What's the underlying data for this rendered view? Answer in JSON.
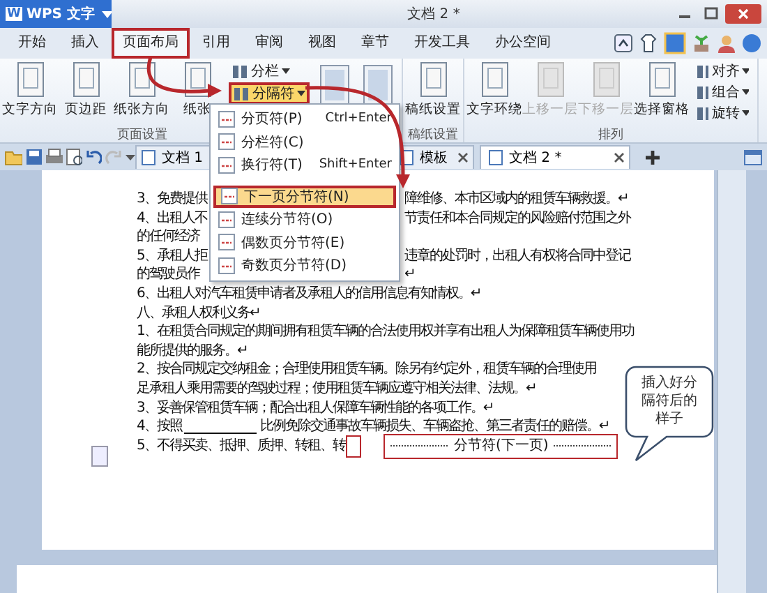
{
  "window": {
    "app_logo": "W",
    "app_button": "WPS 文字",
    "title": "文档 2 *"
  },
  "menu_tabs": [
    {
      "label": "开始",
      "selected": false
    },
    {
      "label": "插入",
      "selected": false
    },
    {
      "label": "页面布局",
      "selected": true
    },
    {
      "label": "引用",
      "selected": false
    },
    {
      "label": "审阅",
      "selected": false
    },
    {
      "label": "视图",
      "selected": false
    },
    {
      "label": "章节",
      "selected": false
    },
    {
      "label": "开发工具",
      "selected": false
    },
    {
      "label": "办公空间",
      "selected": false
    }
  ],
  "ribbon": {
    "groups": [
      {
        "label": "页面设置",
        "items": [
          {
            "kind": "large",
            "label": "文字方向",
            "disabled": false
          },
          {
            "kind": "large",
            "label": "页边距",
            "disabled": false
          },
          {
            "kind": "large",
            "label": "纸张方向",
            "disabled": false
          },
          {
            "kind": "large",
            "label": "纸张",
            "disabled": false
          },
          {
            "kind": "stack",
            "entries": [
              {
                "label": "分栏",
                "selected": false
              },
              {
                "label": "分隔符",
                "selected": true
              }
            ]
          },
          {
            "kind": "icon"
          },
          {
            "kind": "icon"
          }
        ]
      },
      {
        "label": "稿纸设置",
        "items": [
          {
            "kind": "large",
            "label": "稿纸设置",
            "disabled": false
          }
        ]
      },
      {
        "label": "排列",
        "items": [
          {
            "kind": "large",
            "label": "文字环绕",
            "disabled": false
          },
          {
            "kind": "large",
            "label": "上移一层",
            "disabled": true
          },
          {
            "kind": "large",
            "label": "下移一层",
            "disabled": true
          },
          {
            "kind": "large",
            "label": "选择窗格",
            "disabled": false
          },
          {
            "kind": "stack",
            "entries": [
              {
                "label": "对齐",
                "selected": false
              },
              {
                "label": "组合",
                "selected": false
              },
              {
                "label": "旋转",
                "selected": false
              }
            ]
          }
        ]
      }
    ]
  },
  "doc_tabs": [
    {
      "label": "文档 1",
      "selected": false
    },
    {
      "label": "模板",
      "selected": false
    },
    {
      "label": "文档 2 *",
      "selected": true
    }
  ],
  "dropdown": {
    "items": [
      {
        "label": "分页符(P)",
        "shortcut": "Ctrl+Enter",
        "selected": false
      },
      {
        "label": "分栏符(C)",
        "selected": false
      },
      {
        "label": "换行符(T)",
        "shortcut": "Shift+Enter",
        "selected": false
      },
      {
        "label": "下一页分节符(N)",
        "selected": true
      },
      {
        "label": "连续分节符(O)",
        "selected": false
      },
      {
        "label": "偶数页分节符(E)",
        "selected": false
      },
      {
        "label": "奇数页分节符(D)",
        "selected": false
      }
    ]
  },
  "document": {
    "lines": [
      {
        "kind": "split",
        "text": "3、免费提供",
        "right": "障维修、本市区域内的租赁车辆救援。↵"
      },
      {
        "kind": "split",
        "text": "4、出租人不",
        "right": "节责任和本合同规定的风险赔付范围之外"
      },
      {
        "kind": "plain",
        "text": "的任何经济"
      },
      {
        "kind": "split",
        "text": "5、承租人拒",
        "right": "违章的处罚时，出租人有权将合同中登记"
      },
      {
        "kind": "split",
        "text": "的驾驶员作",
        "right": "↵"
      },
      {
        "kind": "plain",
        "text": "6、出租人对汽车租赁申请者及承租人的信用信息有知情权。↵"
      },
      {
        "kind": "plain",
        "text": "八、承租人权利义务↵"
      },
      {
        "kind": "plain",
        "text": "1、在租赁合同规定的期间拥有租赁车辆的合法使用权并享有出租人为保障租赁车辆使用功"
      },
      {
        "kind": "plain",
        "text": "能所提供的服务。↵"
      },
      {
        "kind": "plain",
        "text": "2、按合同规定交纳租金；合理使用租赁车辆。除另有约定外，租赁车辆的合理使用"
      },
      {
        "kind": "plain",
        "text": "足承租人乘用需要的驾驶过程；使用租赁车辆应遵守相关法律、法规。↵"
      },
      {
        "kind": "plain",
        "text": "3、妥善保管租赁车辆；配合出租人保障车辆性能的各项工作。↵"
      },
      {
        "kind": "fill",
        "text": "4、按照",
        "right": "比例免除交通事故车辆损失、车辆盗抢、第三者责任的赔偿。↵"
      },
      {
        "kind": "break",
        "text": "5、不得买卖、抵押、质押、转租、转",
        "right": "分节符(下一页)"
      }
    ]
  },
  "callout": {
    "text": "插入好分隔符后的样子"
  }
}
